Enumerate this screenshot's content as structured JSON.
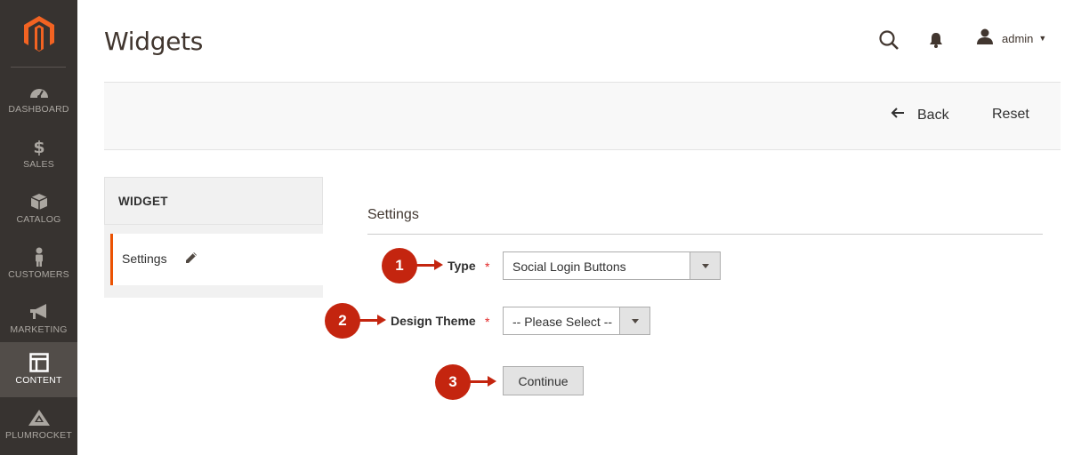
{
  "sidebar": {
    "logo": "magento-logo",
    "items": [
      {
        "label": "DASHBOARD",
        "icon": "dashboard-gauge-icon"
      },
      {
        "label": "SALES",
        "icon": "dollar-icon"
      },
      {
        "label": "CATALOG",
        "icon": "box-icon"
      },
      {
        "label": "CUSTOMERS",
        "icon": "person-icon"
      },
      {
        "label": "MARKETING",
        "icon": "megaphone-icon"
      },
      {
        "label": "CONTENT",
        "icon": "layout-icon",
        "active": true
      },
      {
        "label": "PLUMROCKET",
        "icon": "plumrocket-icon"
      }
    ]
  },
  "header": {
    "title": "Widgets",
    "user": "admin"
  },
  "actions": {
    "back": "Back",
    "reset": "Reset"
  },
  "tabs": {
    "heading": "WIDGET",
    "items": [
      {
        "label": "Settings",
        "icon": "pencil-icon"
      }
    ]
  },
  "settings": {
    "title": "Settings",
    "type_label": "Type",
    "type_value": "Social Login Buttons",
    "theme_label": "Design Theme",
    "theme_value": "-- Please Select --",
    "required_mark": "*",
    "continue": "Continue"
  },
  "callouts": [
    "1",
    "2",
    "3"
  ],
  "colors": {
    "sidebar_bg": "#373330",
    "sidebar_active": "#524d49",
    "accent_orange": "#eb5202",
    "callout_red": "#c4250f",
    "required_red": "#e22626"
  }
}
